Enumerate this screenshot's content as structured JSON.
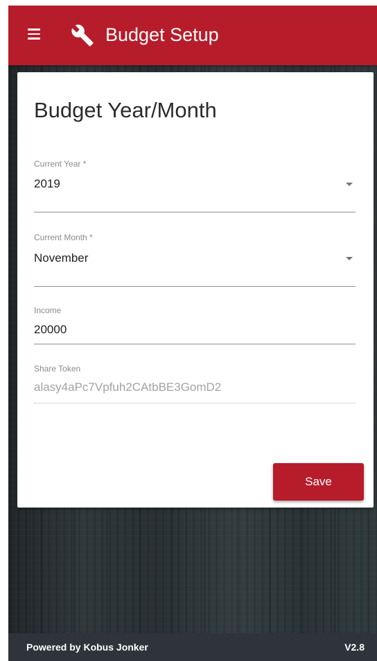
{
  "header": {
    "title": "Budget Setup",
    "menu_icon": "hamburger-menu-icon",
    "title_icon": "wrench-icon",
    "background_color": "#b71c2a"
  },
  "card": {
    "title": "Budget Year/Month",
    "fields": {
      "year": {
        "label": "Current Year *",
        "value": "2019",
        "type": "select"
      },
      "month": {
        "label": "Current Month *",
        "value": "November",
        "type": "select"
      },
      "income": {
        "label": "Income",
        "value": "20000",
        "type": "text"
      },
      "share_token": {
        "label": "Share Token",
        "value": "alasy4aPc7Vpfuh2CAtbBE3GomD2",
        "type": "readonly"
      }
    },
    "save_label": "Save"
  },
  "footer": {
    "credit": "Powered by Kobus Jonker",
    "version": "V2.8"
  },
  "colors": {
    "accent": "#b71c2a",
    "footer": "#2e3439"
  }
}
